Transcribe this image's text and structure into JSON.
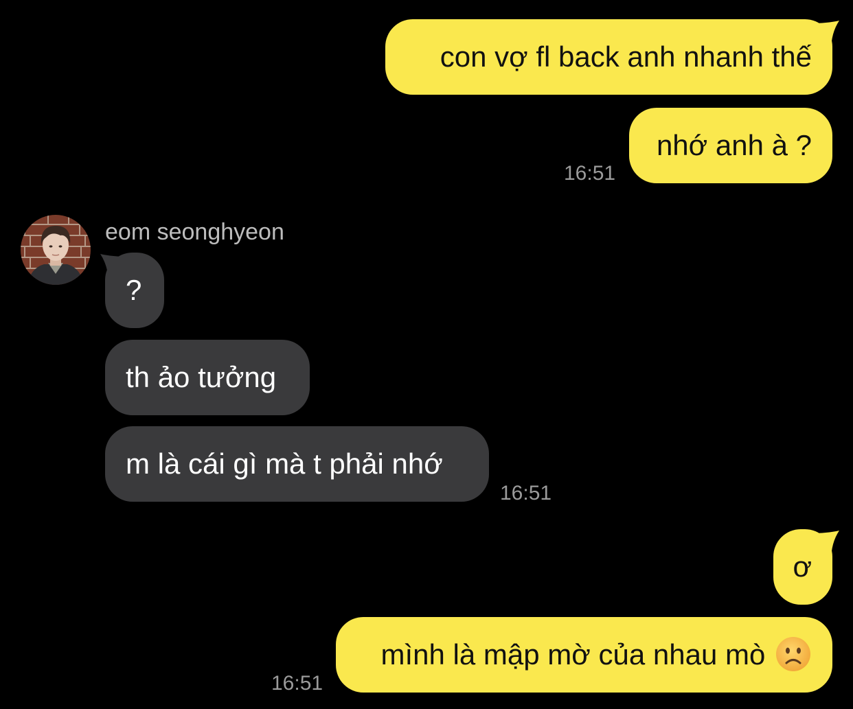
{
  "conversation": {
    "messages": [
      {
        "from": "me",
        "text": "con vợ fl back anh nhanh thế"
      },
      {
        "from": "me",
        "text": "nhớ anh à ?",
        "time": "16:51"
      },
      {
        "from": "them",
        "sender": "eom seonghyeon",
        "text": "?"
      },
      {
        "from": "them",
        "text": "th ảo tưởng"
      },
      {
        "from": "them",
        "text": "m là cái gì mà t phải nhớ",
        "time": "16:51"
      },
      {
        "from": "me",
        "text": "ơ"
      },
      {
        "from": "me",
        "text": "mình là mập mờ của nhau mò",
        "emoji": "frowning-face",
        "time": "16:51"
      }
    ]
  },
  "contact": {
    "name": "eom seonghyeon",
    "avatar": "profile-photo"
  },
  "colors": {
    "background": "#000000",
    "outgoing_bubble": "#fae84e",
    "incoming_bubble": "#3a3a3c",
    "timestamp": "#9b9b9b"
  }
}
